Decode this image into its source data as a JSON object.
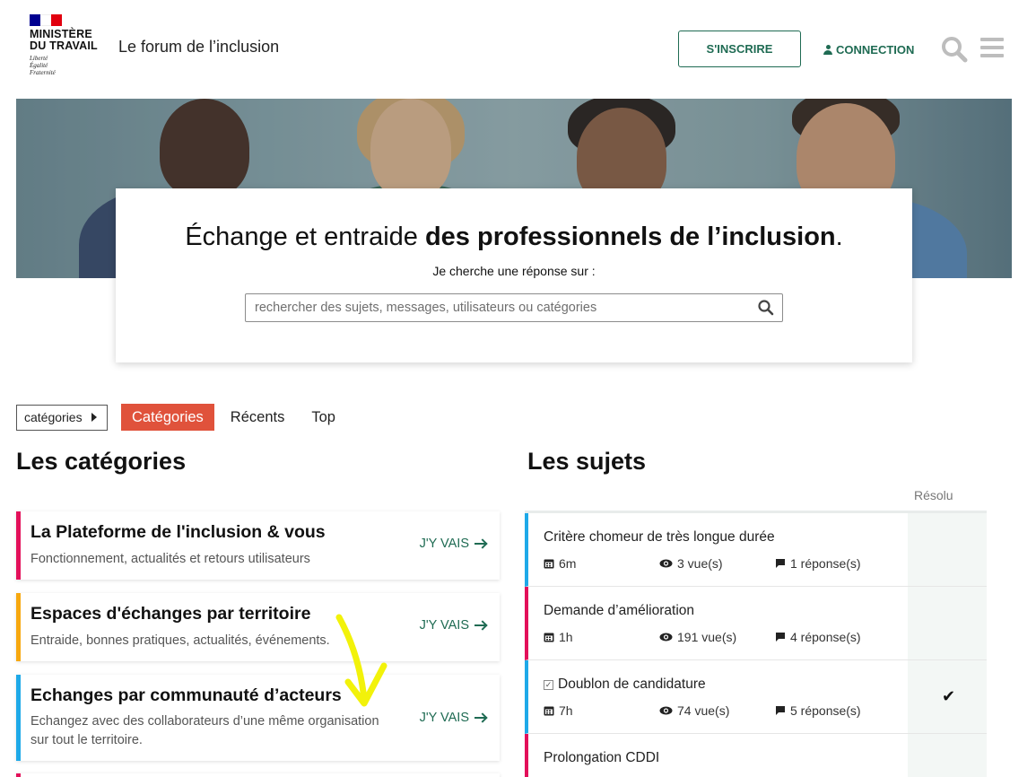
{
  "header": {
    "ministry_line1": "MINISTÈRE",
    "ministry_line2": "DU TRAVAIL",
    "motto": [
      "Liberté",
      "Égalité",
      "Fraternité"
    ],
    "site_title": "Le forum de l’inclusion",
    "signup_label": "S'INSCRIRE",
    "login_label": "CONNECTION",
    "search_icon": "search-icon",
    "menu_icon": "hamburger-icon"
  },
  "hero": {
    "headline_regular": "Échange et entraide ",
    "headline_bold": "des professionnels de l’inclusion",
    "headline_end": ".",
    "subtitle": "Je cherche une réponse sur :",
    "search_placeholder": "rechercher des sujets, messages, utilisateurs ou catégories"
  },
  "nav": {
    "dropdown_label": "catégories",
    "tabs": [
      "Catégories",
      "Récents",
      "Top"
    ],
    "active_tab": "Catégories"
  },
  "categories": {
    "title": "Les catégories",
    "go_label": "J'Y VAIS",
    "items": [
      {
        "title": "La Plateforme de l'inclusion & vous",
        "description": "Fonctionnement, actualités et retours utilisateurs",
        "color": "#e3105a"
      },
      {
        "title": "Espaces d'échanges par territoire",
        "description": "Entraide, bonnes pratiques, actualités, événements.",
        "color": "#f7a80f"
      },
      {
        "title": "Echanges par communauté d’acteurs",
        "description": "Echangez avec des collaborateurs d’une même organisation sur tout le territoire.",
        "color": "#1ea9e8"
      }
    ]
  },
  "topics": {
    "title": "Les sujets",
    "resolved_header": "Résolu",
    "items": [
      {
        "title": "Critère chomeur de très longue durée",
        "age": "6m",
        "views": "3 vue(s)",
        "replies": "1 réponse(s)",
        "resolved": false,
        "color": "#1ea9e8"
      },
      {
        "title": "Demande d’amélioration",
        "age": "1h",
        "views": "191 vue(s)",
        "replies": "4 réponse(s)",
        "resolved": false,
        "color": "#e3105a"
      },
      {
        "title": "Doublon de candidature",
        "age": "7h",
        "views": "74 vue(s)",
        "replies": "5 réponse(s)",
        "resolved": true,
        "color": "#1ea9e8"
      },
      {
        "title": "Prolongation CDDI",
        "color": "#e3105a"
      }
    ]
  },
  "colors": {
    "brand_green": "#1f6b53",
    "active_tab": "#e0523b",
    "flag_blue": "#000091",
    "flag_red": "#e1000f"
  }
}
